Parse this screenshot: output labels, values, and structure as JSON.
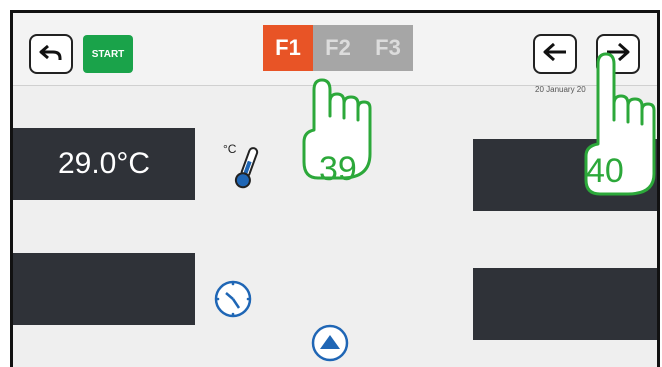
{
  "toolbar": {
    "start_label": "START"
  },
  "tabs": [
    {
      "label": "F1",
      "active": true
    },
    {
      "label": "F2",
      "active": false
    },
    {
      "label": "F3",
      "active": false
    }
  ],
  "header": {
    "date": "20 January 20"
  },
  "panels": {
    "temperature": "29.0°C",
    "temperature_unit_icon": "°C"
  },
  "annotations": {
    "hand_a": "39",
    "hand_b": "40"
  },
  "colors": {
    "accent": "#e85426",
    "start_green": "#1aa34a",
    "icon_blue": "#1f66b5",
    "annotation_green": "#2ca83a"
  },
  "icons": {
    "back": "undo-arrow-icon",
    "prev": "arrow-left-icon",
    "next": "arrow-right-icon",
    "thermometer": "thermometer-icon",
    "clock": "clock-icon",
    "scroll_up": "triangle-up-icon",
    "hand": "tap-hand-icon"
  }
}
